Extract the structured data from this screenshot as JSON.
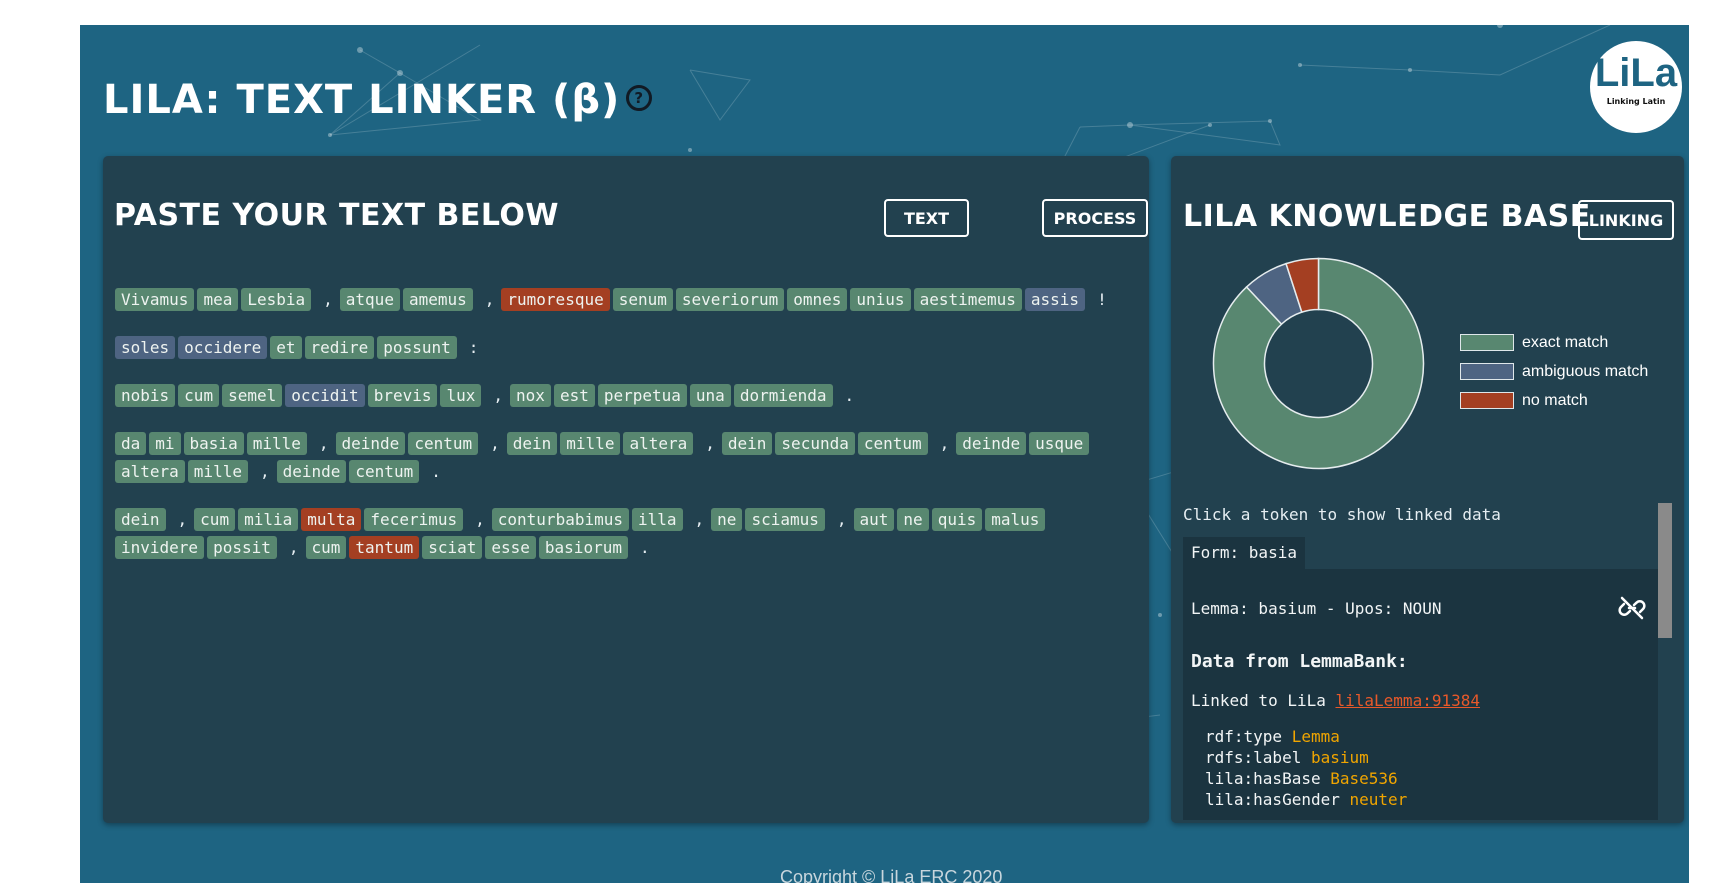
{
  "header": {
    "title": "LILA: TEXT LINKER (β)",
    "help_icon": "question-circle-icon"
  },
  "logo": {
    "mark": "LiLa",
    "sub": "Linking Latin"
  },
  "left_panel": {
    "title": "PASTE YOUR TEXT BELOW",
    "text_button": "TEXT",
    "process_button": "PROCESS",
    "lines": [
      [
        {
          "t": "Vivamus",
          "s": "exact"
        },
        {
          "t": "mea",
          "s": "exact"
        },
        {
          "t": "Lesbia",
          "s": "exact"
        },
        {
          "t": ",",
          "s": "punct"
        },
        {
          "t": "atque",
          "s": "exact"
        },
        {
          "t": "amemus",
          "s": "exact"
        },
        {
          "t": ",",
          "s": "punct"
        },
        {
          "t": "rumoresque",
          "s": "nomatch"
        },
        {
          "t": "senum",
          "s": "exact"
        },
        {
          "t": "severiorum",
          "s": "exact"
        },
        {
          "t": "omnes",
          "s": "exact"
        },
        {
          "t": "unius",
          "s": "exact"
        },
        {
          "t": "aestimemus",
          "s": "exact"
        },
        {
          "t": "assis",
          "s": "ambiguous"
        },
        {
          "t": "!",
          "s": "punct"
        }
      ],
      [
        {
          "t": "soles",
          "s": "ambiguous"
        },
        {
          "t": "occidere",
          "s": "ambiguous"
        },
        {
          "t": "et",
          "s": "exact"
        },
        {
          "t": "redire",
          "s": "exact"
        },
        {
          "t": "possunt",
          "s": "exact"
        },
        {
          "t": ":",
          "s": "punct"
        }
      ],
      [
        {
          "t": "nobis",
          "s": "exact"
        },
        {
          "t": "cum",
          "s": "exact"
        },
        {
          "t": "semel",
          "s": "exact"
        },
        {
          "t": "occidit",
          "s": "ambiguous"
        },
        {
          "t": "brevis",
          "s": "exact"
        },
        {
          "t": "lux",
          "s": "exact"
        },
        {
          "t": ",",
          "s": "punct"
        },
        {
          "t": "nox",
          "s": "exact"
        },
        {
          "t": "est",
          "s": "exact"
        },
        {
          "t": "perpetua",
          "s": "exact"
        },
        {
          "t": "una",
          "s": "exact"
        },
        {
          "t": "dormienda",
          "s": "exact"
        },
        {
          "t": ".",
          "s": "punct"
        }
      ],
      [
        {
          "t": "da",
          "s": "exact"
        },
        {
          "t": "mi",
          "s": "exact"
        },
        {
          "t": "basia",
          "s": "exact"
        },
        {
          "t": "mille",
          "s": "exact"
        },
        {
          "t": ",",
          "s": "punct"
        },
        {
          "t": "deinde",
          "s": "exact"
        },
        {
          "t": "centum",
          "s": "exact"
        },
        {
          "t": ",",
          "s": "punct"
        },
        {
          "t": "dein",
          "s": "exact"
        },
        {
          "t": "mille",
          "s": "exact"
        },
        {
          "t": "altera",
          "s": "exact"
        },
        {
          "t": ",",
          "s": "punct"
        },
        {
          "t": "dein",
          "s": "exact"
        },
        {
          "t": "secunda",
          "s": "exact"
        },
        {
          "t": "centum",
          "s": "exact"
        },
        {
          "t": ",",
          "s": "punct"
        },
        {
          "t": "deinde",
          "s": "exact"
        },
        {
          "t": "usque",
          "s": "exact"
        },
        {
          "t": "altera",
          "s": "exact"
        },
        {
          "t": "mille",
          "s": "exact"
        },
        {
          "t": ",",
          "s": "punct"
        },
        {
          "t": "deinde",
          "s": "exact"
        },
        {
          "t": "centum",
          "s": "exact"
        },
        {
          "t": ".",
          "s": "punct"
        }
      ],
      [
        {
          "t": "dein",
          "s": "exact"
        },
        {
          "t": ",",
          "s": "punct"
        },
        {
          "t": "cum",
          "s": "exact"
        },
        {
          "t": "milia",
          "s": "exact"
        },
        {
          "t": "multa",
          "s": "nomatch"
        },
        {
          "t": "fecerimus",
          "s": "exact"
        },
        {
          "t": ",",
          "s": "punct"
        },
        {
          "t": "conturbabimus",
          "s": "exact"
        },
        {
          "t": "illa",
          "s": "exact"
        },
        {
          "t": ",",
          "s": "punct"
        },
        {
          "t": "ne",
          "s": "exact"
        },
        {
          "t": "sciamus",
          "s": "exact"
        },
        {
          "t": ",",
          "s": "punct"
        },
        {
          "t": "aut",
          "s": "exact"
        },
        {
          "t": "ne",
          "s": "exact"
        },
        {
          "t": "quis",
          "s": "exact"
        },
        {
          "t": "malus",
          "s": "exact"
        },
        {
          "t": "invidere",
          "s": "exact"
        },
        {
          "t": "possit",
          "s": "exact"
        },
        {
          "t": ",",
          "s": "punct"
        },
        {
          "t": "cum",
          "s": "exact"
        },
        {
          "t": "tantum",
          "s": "nomatch"
        },
        {
          "t": "sciat",
          "s": "exact"
        },
        {
          "t": "esse",
          "s": "exact"
        },
        {
          "t": "basiorum",
          "s": "exact"
        },
        {
          "t": ".",
          "s": "punct"
        }
      ]
    ]
  },
  "right_panel": {
    "title": "LILA KNOWLEDGE BASE",
    "linking_button": "LINKING",
    "hint": "Click a token to show linked data",
    "form_tab": "Form: basia",
    "lemma_line": "Lemma: basium - Upos: NOUN",
    "unlink_icon": "unlink-icon",
    "lemmabank_heading": "Data from LemmaBank:",
    "linked_prefix": "Linked to LiLa ",
    "linked_link": "lilaLemma:91384",
    "rdf": [
      {
        "k": "rdf:type",
        "v": "Lemma"
      },
      {
        "k": "rdfs:label",
        "v": "basium"
      },
      {
        "k": "lila:hasBase",
        "v": "Base536"
      },
      {
        "k": "lila:hasGender",
        "v": "neuter"
      }
    ]
  },
  "chart_data": {
    "type": "pie",
    "donut": true,
    "categories": [
      "exact match",
      "ambiguous match",
      "no match"
    ],
    "values": [
      88,
      7,
      5
    ],
    "colors": [
      "#588770",
      "#4e6482",
      "#a43f22"
    ],
    "legend": "right"
  },
  "colors": {
    "exact": "#588770",
    "ambiguous": "#4e6482",
    "nomatch": "#a43f22",
    "background": "#1e6482",
    "panel": "#22414f"
  },
  "footer": {
    "copyright": "Copyright © LiLa ERC 2020"
  }
}
